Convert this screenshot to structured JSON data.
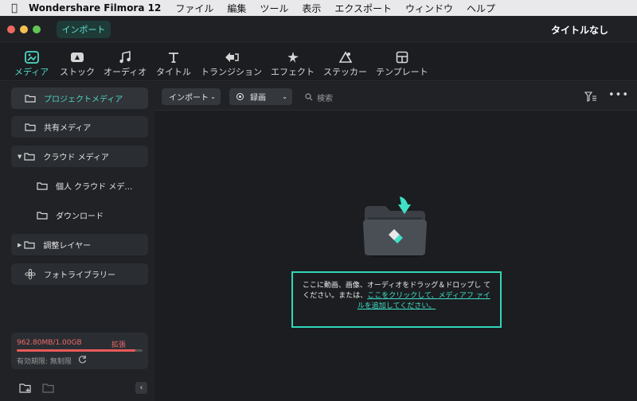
{
  "menubar": {
    "app_name": "Wondershare Filmora 12",
    "items": [
      "ファイル",
      "編集",
      "ツール",
      "表示",
      "エクスポート",
      "ウィンドウ",
      "ヘルプ"
    ]
  },
  "titlebar": {
    "import_label": "インポート",
    "document_title": "タイトルなし"
  },
  "toolbar": {
    "tabs": [
      {
        "label": "メディア",
        "icon": "media-icon"
      },
      {
        "label": "ストック",
        "icon": "stock-icon"
      },
      {
        "label": "オーディオ",
        "icon": "music-note-icon"
      },
      {
        "label": "タイトル",
        "icon": "title-t-icon"
      },
      {
        "label": "トランジション",
        "icon": "transition-icon"
      },
      {
        "label": "エフェクト",
        "icon": "effect-sparkle-icon"
      },
      {
        "label": "ステッカー",
        "icon": "sticker-icon"
      },
      {
        "label": "テンプレート",
        "icon": "template-icon"
      }
    ],
    "active_tab": "メディア"
  },
  "sidebar": {
    "items": [
      {
        "label": "プロジェクトメディア"
      },
      {
        "label": "共有メディア"
      },
      {
        "label": "クラウド メディア"
      },
      {
        "label": "個人 クラウド メデ…"
      },
      {
        "label": "ダウンロード"
      },
      {
        "label": "調整レイヤー"
      },
      {
        "label": "フォトライブラリー"
      }
    ],
    "storage": {
      "used": "962.80MB/1.00GB",
      "used_fraction": 0.94,
      "expand_label": "拡張",
      "expiry": "有効期限: 無制限"
    }
  },
  "content": {
    "import_dropdown": "インポート",
    "record_dropdown": "録画",
    "search_placeholder": "検索",
    "drop_text_1": "ここに動画、画像、オーディオをドラッグ＆ドロップし てください。または、",
    "drop_link": "ここをクリックして、メディアフ ァイルを追加してください。"
  },
  "colors": {
    "accent": "#4fd6c3",
    "storage_bar": "#e85a5a",
    "background": "#1b1d21"
  }
}
